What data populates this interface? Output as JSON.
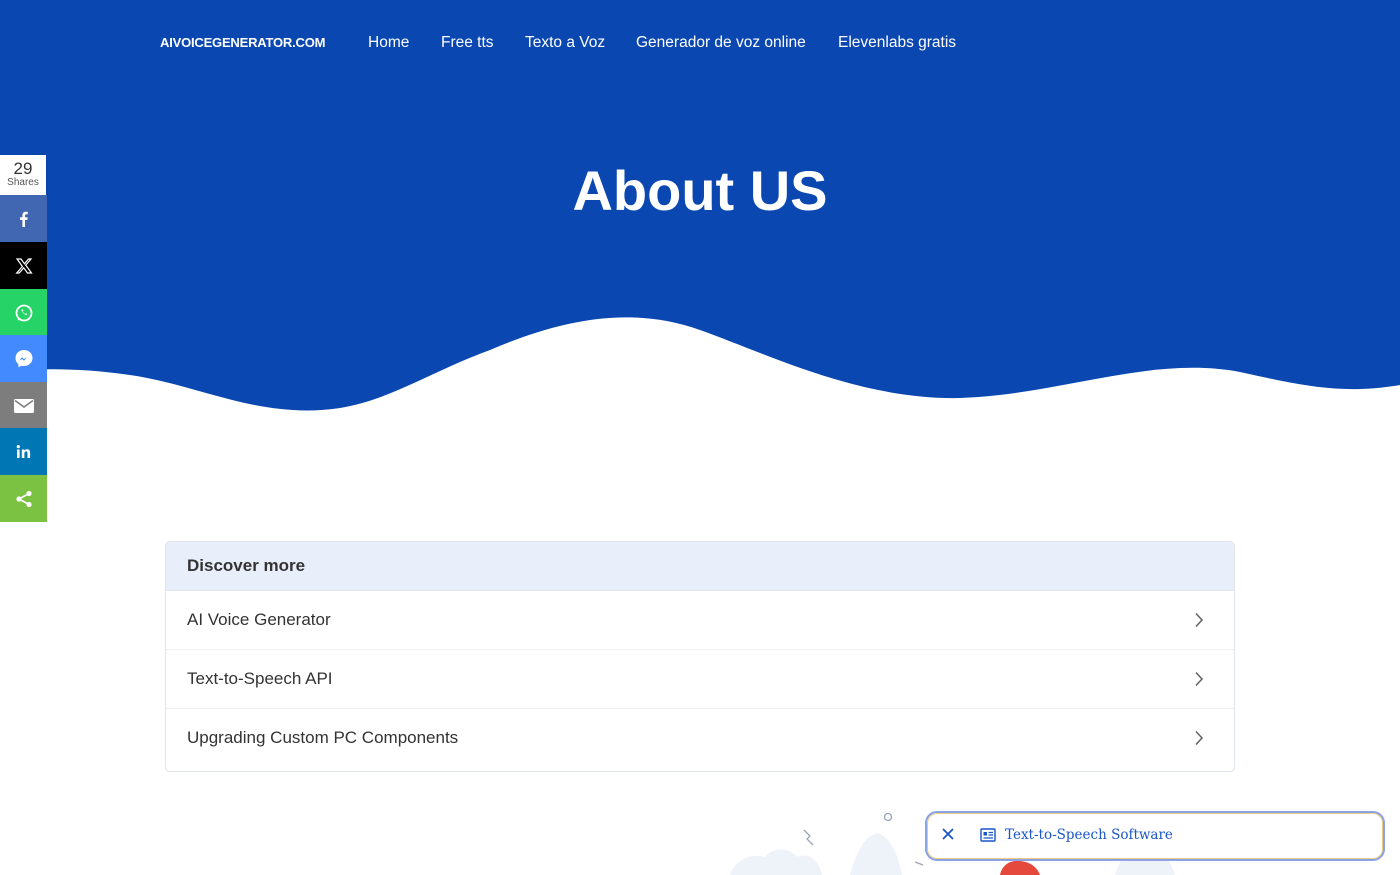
{
  "nav": {
    "brand": "AIVOICEGENERATOR.COM",
    "links": [
      "Home",
      "Free tts",
      "Texto a Voz",
      "Generador de voz online",
      "Elevenlabs gratis"
    ]
  },
  "hero": {
    "title": "About US"
  },
  "share": {
    "count": "29",
    "label": "Shares",
    "buttons": [
      {
        "name": "facebook",
        "color": "#4267b2"
      },
      {
        "name": "x",
        "color": "#000000"
      },
      {
        "name": "whatsapp",
        "color": "#25d366"
      },
      {
        "name": "messenger",
        "color": "#448aff"
      },
      {
        "name": "email",
        "color": "#7d7d7d"
      },
      {
        "name": "linkedin",
        "color": "#0077b5"
      },
      {
        "name": "share",
        "color": "#7bc142"
      }
    ]
  },
  "discover": {
    "heading": "Discover more",
    "items": [
      "AI Voice Generator",
      "Text-to-Speech API",
      "Upgrading Custom PC Components"
    ]
  },
  "chip": {
    "label": "Text-to-Speech Software"
  },
  "colors": {
    "hero_blue": "#0a47b0"
  }
}
